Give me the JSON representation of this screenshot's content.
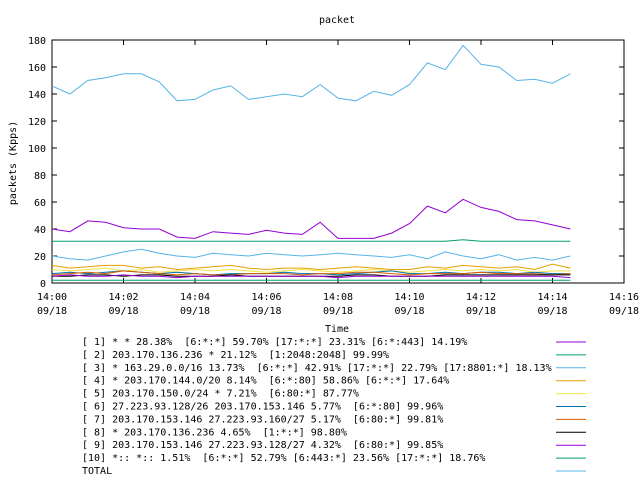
{
  "chart_data": {
    "type": "line",
    "title": "packet",
    "xlabel": "Time",
    "ylabel": "packets (Kpps)",
    "ylim": [
      0,
      180
    ],
    "yticks": [
      0,
      20,
      40,
      60,
      80,
      100,
      120,
      140,
      160,
      180
    ],
    "xlim": [
      "2025-09-18T14:00",
      "2025-09-18T14:16"
    ],
    "xticks": [
      {
        "time": "14:00",
        "date": "09/18"
      },
      {
        "time": "14:02",
        "date": "09/18"
      },
      {
        "time": "14:04",
        "date": "09/18"
      },
      {
        "time": "14:06",
        "date": "09/18"
      },
      {
        "time": "14:08",
        "date": "09/18"
      },
      {
        "time": "14:10",
        "date": "09/18"
      },
      {
        "time": "14:12",
        "date": "09/18"
      },
      {
        "time": "14:14",
        "date": "09/18"
      },
      {
        "time": "14:16",
        "date": "09/18"
      }
    ],
    "grid": false,
    "legend_placement": "below",
    "x": [
      "14:00:00",
      "14:00:30",
      "14:01:00",
      "14:01:30",
      "14:02:00",
      "14:02:30",
      "14:03:00",
      "14:03:30",
      "14:04:00",
      "14:04:30",
      "14:05:00",
      "14:05:30",
      "14:06:00",
      "14:06:30",
      "14:07:00",
      "14:07:30",
      "14:08:00",
      "14:08:30",
      "14:09:00",
      "14:09:30",
      "14:10:00",
      "14:10:30",
      "14:11:00",
      "14:11:30",
      "14:12:00",
      "14:12:30",
      "14:13:00",
      "14:13:30",
      "14:14:00",
      "14:14:30"
    ],
    "series": [
      {
        "name": "[ 1] * * 28.38%  [6:*:*] 59.70% [17:*:*] 23.31% [6:*:443] 14.19%",
        "color": "#9400d3",
        "values": [
          40,
          38,
          46,
          45,
          41,
          40,
          40,
          34,
          33,
          38,
          37,
          36,
          39,
          37,
          36,
          45,
          33,
          33,
          33,
          37,
          44,
          57,
          52,
          62,
          56,
          53,
          47,
          46,
          43,
          40
        ]
      },
      {
        "name": "[ 2] 203.170.136.236 * 21.12%  [1:2048:2048] 99.99%",
        "color": "#009e73",
        "values": [
          31,
          31,
          31,
          31,
          31,
          31,
          31,
          31,
          31,
          31,
          31,
          31,
          31,
          31,
          31,
          31,
          31,
          31,
          31,
          31,
          31,
          31,
          31,
          32,
          31,
          31,
          31,
          31,
          31,
          31
        ]
      },
      {
        "name": "[ 3] * 163.29.0.0/16 13.73%  [6:*:*] 42.91% [17:*:*] 22.79% [17:8801:*] 18.13%",
        "color": "#56b4e9",
        "values": [
          20,
          18,
          17,
          20,
          23,
          25,
          22,
          20,
          19,
          22,
          21,
          20,
          22,
          21,
          20,
          21,
          22,
          21,
          20,
          19,
          21,
          18,
          23,
          20,
          18,
          21,
          17,
          19,
          17,
          20
        ]
      },
      {
        "name": "[ 4] * 203.170.144.0/20 8.14%  [6:*:80] 58.86% [6:*:*] 17.64%",
        "color": "#e69f00",
        "values": [
          13,
          11,
          12,
          13,
          13,
          11,
          12,
          10,
          11,
          12,
          13,
          11,
          10,
          11,
          11,
          10,
          11,
          12,
          11,
          10,
          10,
          12,
          11,
          13,
          12,
          11,
          12,
          10,
          14,
          11
        ]
      },
      {
        "name": "[ 5] 203.170.150.0/24 * 7.21%  [6:80:*] 87.77%",
        "color": "#f0e442",
        "values": [
          10,
          9,
          10,
          11,
          9,
          10,
          8,
          9,
          10,
          9,
          10,
          9,
          8,
          9,
          10,
          9,
          8,
          9,
          10,
          9,
          8,
          9,
          10,
          9,
          10,
          9,
          10,
          8,
          9,
          9
        ]
      },
      {
        "name": "[ 6] 27.223.93.128/26 203.170.153.146 5.77%  [6:*:80] 99.96%",
        "color": "#0072b2",
        "values": [
          7,
          8,
          7,
          8,
          9,
          8,
          7,
          8,
          7,
          6,
          7,
          7,
          7,
          8,
          7,
          7,
          6,
          7,
          8,
          9,
          7,
          7,
          8,
          7,
          8,
          8,
          7,
          8,
          7,
          7
        ]
      },
      {
        "name": "[ 7] 203.170.153.146 27.223.93.160/27 5.17%  [6:80:*] 99.81%",
        "color": "#d55e00",
        "values": [
          6,
          7,
          8,
          7,
          9,
          8,
          7,
          6,
          7,
          6,
          6,
          7,
          7,
          7,
          6,
          7,
          7,
          8,
          8,
          7,
          6,
          7,
          7,
          7,
          8,
          7,
          7,
          7,
          6,
          7
        ]
      },
      {
        "name": "[ 8] * 203.170.136.236 4.65%  [1:*:*] 98.80%",
        "color": "#000000",
        "values": [
          5,
          5,
          6,
          6,
          5,
          6,
          6,
          5,
          5,
          5,
          6,
          5,
          5,
          5,
          5,
          5,
          5,
          6,
          6,
          5,
          5,
          5,
          6,
          6,
          6,
          6,
          6,
          6,
          6,
          6
        ]
      },
      {
        "name": "[ 9] 203.170.153.146 27.223.93.128/27 4.32%  [6:80:*] 99.85%",
        "color": "#9400d3",
        "values": [
          5,
          6,
          5,
          5,
          6,
          5,
          5,
          4,
          5,
          5,
          5,
          5,
          5,
          5,
          5,
          5,
          4,
          5,
          5,
          5,
          5,
          5,
          5,
          5,
          5,
          5,
          5,
          5,
          5,
          4
        ]
      },
      {
        "name": "[10] *:: *:: 1.51%  [6:*:*] 52.79% [6:443:*] 23.56% [17:*:*] 18.76%",
        "color": "#009e73",
        "values": [
          2,
          2,
          2,
          2,
          2,
          2,
          2,
          2,
          2,
          2,
          2,
          2,
          2,
          2,
          2,
          2,
          2,
          2,
          2,
          2,
          2,
          2,
          2,
          2,
          2,
          2,
          2,
          2,
          2,
          2
        ]
      },
      {
        "name": "TOTAL",
        "color": "#56b4e9",
        "values": [
          146,
          140,
          150,
          152,
          155,
          155,
          149,
          135,
          136,
          143,
          146,
          136,
          138,
          140,
          138,
          147,
          137,
          135,
          142,
          139,
          147,
          163,
          158,
          176,
          162,
          160,
          150,
          151,
          148,
          155
        ]
      }
    ]
  }
}
